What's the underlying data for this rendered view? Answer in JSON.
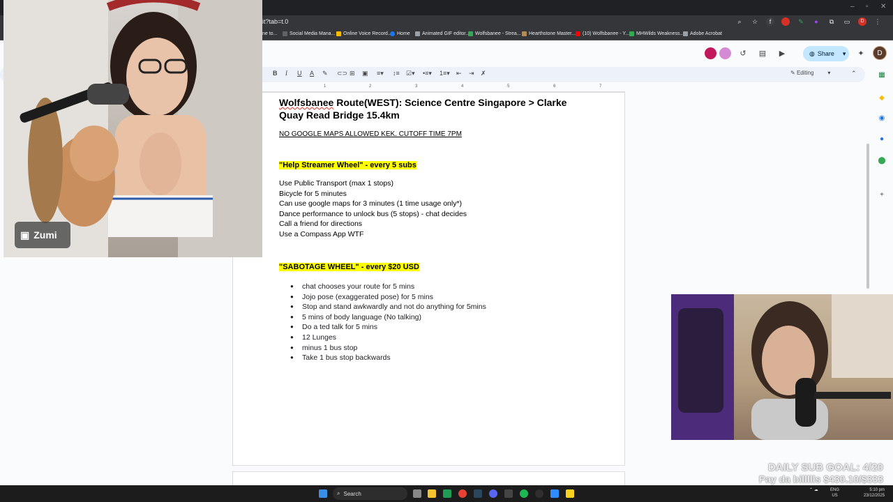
{
  "browser": {
    "url": "it?tab=t.0",
    "bookmarks": [
      "ne to...",
      "Social Media Mana...",
      "Online Voice Record...",
      "Home",
      "Animated GIF editor...",
      "Wolfsbanee - Strea...",
      "Hearthstone Master...",
      "(10) Wolfsbanee - Y...",
      "MHWilds Weakness...",
      "Adobe Acrobat"
    ]
  },
  "docs_header": {
    "share_label": "Share",
    "avatar_initial": "D",
    "mode_label": "Editing"
  },
  "ruler_numbers": [
    "1",
    "2",
    "3",
    "4",
    "5",
    "6",
    "7"
  ],
  "document": {
    "title_word": "Wolfsbanee",
    "title_rest": " Route(WEST): Science Centre Singapore > Clarke",
    "title_line2": "Quay Read Bridge 15.4km",
    "subline": "NO GOOGLE MAPS ALLOWED KEK. CUTOFF TIME 7PM",
    "help_heading": "\"Help Streamer Wheel\" - every 5 subs",
    "help_options": [
      "Use Public Transport (max 1 stops)",
      "Bicycle for 5 minutes",
      "Can use google maps for 3 minutes (1 time usage only*)",
      "Dance performance to unlock bus (5 stops) - chat decides",
      "Call a friend for directions",
      "Use a Compass App WTF"
    ],
    "sabotage_heading": "\"SABOTAGE WHEEL\" - every $20 USD",
    "sabotage_options": [
      "chat chooses your route for 5 mins",
      "Jojo pose (exaggerated pose) for 5 mins",
      "Stop and stand awkwardly and not do anything for 5mins",
      "5 mins of body language (No talking)",
      "Do a ted talk for 5 mins",
      "12 Lunges",
      "minus 1 bus stop",
      "Take 1 bus stop backwards"
    ]
  },
  "overlay": {
    "twitch_name": "Zumi",
    "goal_line1": "DAILY SUB GOAL: 4/20",
    "goal_line2": "Pay da billllls $430.10/$333"
  },
  "taskbar": {
    "search_label": "Search",
    "lang_line1": "ENG",
    "lang_line2": "US",
    "time": "5:10 pm",
    "date": "23/12/2025"
  },
  "colors": {
    "highlight": "#ffff00",
    "share_bg": "#c2e7ff",
    "page_bg": "#ffffff",
    "app_bg": "#f9fbfd"
  }
}
